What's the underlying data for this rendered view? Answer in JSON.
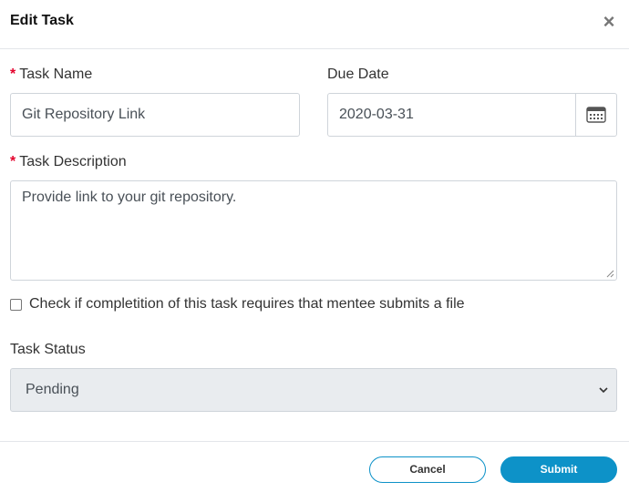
{
  "modal": {
    "title": "Edit Task",
    "close_glyph": "×"
  },
  "task_name": {
    "required_mark": "*",
    "label": "Task Name",
    "value": "Git Repository Link"
  },
  "due_date": {
    "label": "Due Date",
    "value": "2020-03-31",
    "icon": "calendar-icon"
  },
  "task_description": {
    "required_mark": "*",
    "label": "Task Description",
    "value": "Provide link to your git repository."
  },
  "file_requirement": {
    "label": "Check if completition of this task requires that mentee submits a file",
    "checked": false
  },
  "task_status": {
    "label": "Task Status",
    "selected": "Pending"
  },
  "footer": {
    "cancel_label": "Cancel",
    "submit_label": "Submit"
  },
  "colors": {
    "accent": "#0d92c8",
    "required": "#e4002b",
    "select_bg": "#e9ecef"
  }
}
